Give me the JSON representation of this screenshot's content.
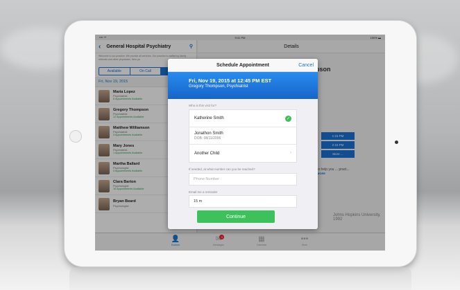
{
  "status": {
    "carrier": "•••• ᯤ",
    "time": "9:41 PM",
    "battery": "100% ▬"
  },
  "left": {
    "title": "General Hospital Psychiatry",
    "intro": "Welcome to our practice. We provide all services. Our practice is staffed by family referrals and other physicians. New pa",
    "segments": [
      "Available",
      "On Call",
      "Ap"
    ],
    "date_header": "Fri, Nov 19, 2015",
    "providers": [
      {
        "name": "Maria Lopez",
        "role": "Psychiatrist",
        "avail": "6 Appointments Available"
      },
      {
        "name": "Gregory Thompson",
        "role": "Psychiatrist",
        "avail": "12 Appointments Available"
      },
      {
        "name": "Matthew Williamson",
        "role": "Psychiatrist",
        "avail": "3 Appointments Available"
      },
      {
        "name": "Mary Jones",
        "role": "Psychiatrist",
        "avail": "1 Appointments Available"
      },
      {
        "name": "Martha Ballard",
        "role": "Psychologist",
        "avail": "4 Appointments Available"
      },
      {
        "name": "Clara Barton",
        "role": "Psychologist",
        "avail": "16 Appointments Available"
      },
      {
        "name": "Bryan Beard",
        "role": "Psychologist",
        "avail": ""
      }
    ]
  },
  "right": {
    "title": "Details",
    "name_partial": "pson",
    "slots": [
      "1:15 PM",
      "2:15 PM",
      "More ..."
    ],
    "help_text": "to help you ... pract...",
    "more_link": "MORE",
    "school": "Johns Hopkins University, 1992"
  },
  "tabs": [
    {
      "label": "Doctors",
      "icon": "person-icon"
    },
    {
      "label": "Messages",
      "icon": "mail-icon",
      "badge": "3"
    },
    {
      "label": "Calendar",
      "icon": "calendar-icon"
    },
    {
      "label": "More",
      "icon": "more-icon"
    }
  ],
  "modal": {
    "title": "Schedule Appointment",
    "cancel": "Cancel",
    "banner_line1": "Fri, Nov 19, 2015 at 12:45 PM EST",
    "banner_line2": "Gregory Thompson, Psychiatrist",
    "who_label": "Who is this visit for?",
    "patients": [
      {
        "name": "Katherine Smith",
        "sub": "",
        "selected": true
      },
      {
        "name": "Jonathon Smith",
        "sub": "DOB: 08/11/2006",
        "selected": false
      },
      {
        "name": "Another Child",
        "sub": "",
        "selected": false
      }
    ],
    "phone_label": "If needed, at what number can you be reached?",
    "phone_placeholder": "Phone Number",
    "reminder_label": "Email me a reminder",
    "reminder_value": "15 m",
    "continue": "Continue"
  },
  "colors": {
    "accent": "#1a73d6",
    "success": "#3cc15c",
    "badge": "#e22233"
  }
}
